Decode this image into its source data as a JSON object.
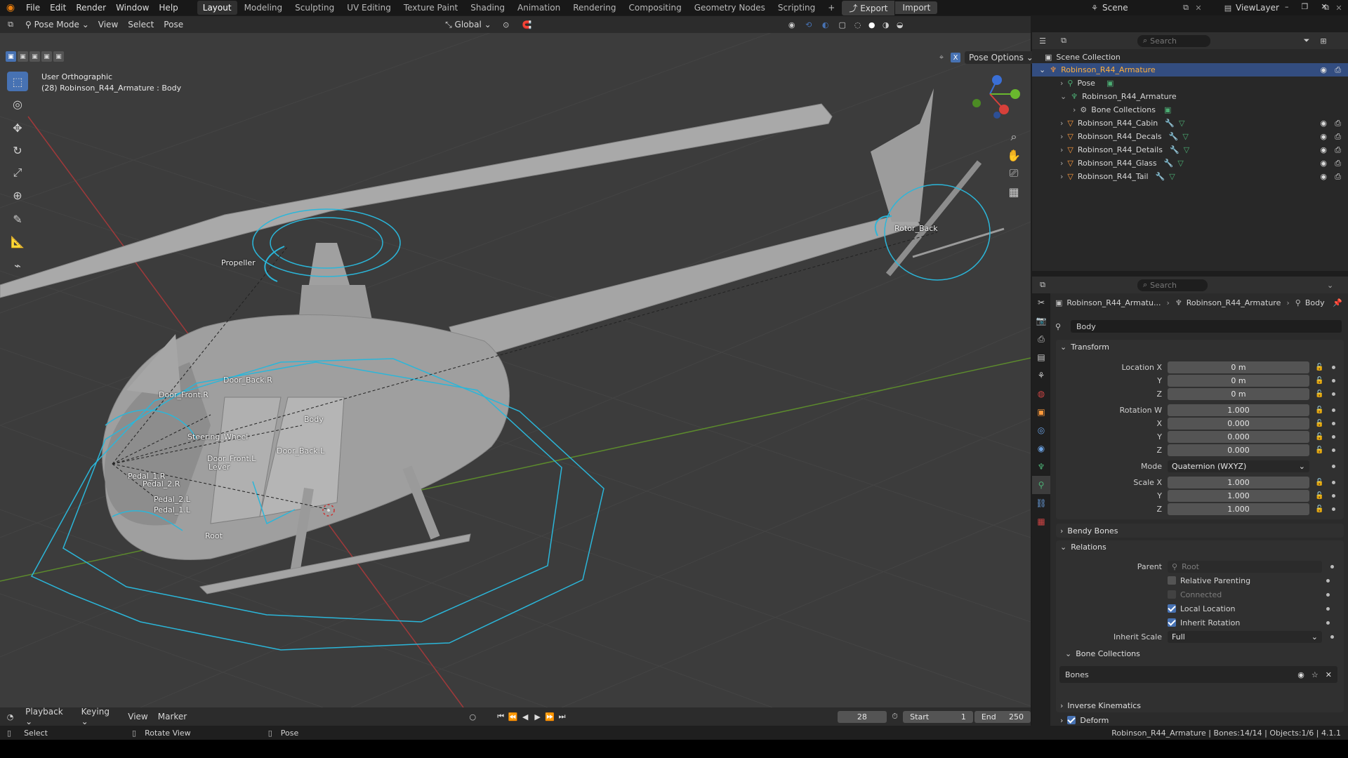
{
  "topbar": {
    "menus": [
      "File",
      "Edit",
      "Render",
      "Window",
      "Help"
    ],
    "workspaces": [
      "Layout",
      "Modeling",
      "Sculpting",
      "UV Editing",
      "Texture Paint",
      "Shading",
      "Animation",
      "Rendering",
      "Compositing",
      "Geometry Nodes",
      "Scripting"
    ],
    "active_workspace": "Layout",
    "export_label": "Export",
    "import_label": "Import",
    "scene_label": "Scene",
    "viewlayer_label": "ViewLayer"
  },
  "viewport": {
    "mode": "Pose Mode",
    "menus": [
      "View",
      "Select",
      "Pose"
    ],
    "orientation": "Global",
    "pose_options": "Pose Options",
    "view_name": "User Orthographic",
    "active_info": "(28) Robinson_R44_Armature : Body",
    "bone_labels": [
      "Propeller",
      "Rotor_Back",
      "Door_Back.R",
      "Door_Front.R",
      "Body",
      "Steering_Wheel",
      "Door_Back.L",
      "Door_Front.L",
      "Lever",
      "Pedal_1.R",
      "Pedal_2.R",
      "Pedal_2.L",
      "Pedal_1.L",
      "Root"
    ]
  },
  "outliner": {
    "search_placeholder": "Search",
    "root": "Scene Collection",
    "items": [
      {
        "label": "Robinson_R44_Armature",
        "selected": true
      },
      {
        "label": "Pose"
      },
      {
        "label": "Robinson_R44_Armature"
      },
      {
        "label": "Bone Collections"
      },
      {
        "label": "Robinson_R44_Cabin"
      },
      {
        "label": "Robinson_R44_Decals"
      },
      {
        "label": "Robinson_R44_Details"
      },
      {
        "label": "Robinson_R44_Glass"
      },
      {
        "label": "Robinson_R44_Tail"
      }
    ]
  },
  "properties": {
    "search_placeholder": "Search",
    "breadcrumb": [
      "Robinson_R44_Armatu...",
      "Robinson_R44_Armature",
      "Body"
    ],
    "bone_name": "Body",
    "transform": {
      "title": "Transform",
      "location_label": "Location X",
      "location": [
        "0 m",
        "0 m",
        "0 m"
      ],
      "rotation_label": "Rotation W",
      "rotation": [
        "1.000",
        "0.000",
        "0.000",
        "0.000"
      ],
      "mode_label": "Mode",
      "mode": "Quaternion (WXYZ)",
      "scale_label": "Scale X",
      "scale": [
        "1.000",
        "1.000",
        "1.000"
      ],
      "axis_x": "X",
      "axis_y": "Y",
      "axis_z": "Z"
    },
    "bendy_bones": "Bendy Bones",
    "relations": {
      "title": "Relations",
      "parent_label": "Parent",
      "parent_value": "Root",
      "relative_parenting": "Relative Parenting",
      "connected": "Connected",
      "local_location": "Local Location",
      "inherit_rotation": "Inherit Rotation",
      "inherit_scale_label": "Inherit Scale",
      "inherit_scale": "Full",
      "bone_collections": "Bone Collections",
      "bones_item": "Bones"
    },
    "inverse_kinematics": "Inverse Kinematics",
    "deform": "Deform"
  },
  "timeline": {
    "menus": [
      "Playback",
      "Keying",
      "View",
      "Marker"
    ],
    "current_frame": "28",
    "start_label": "Start",
    "start": "1",
    "end_label": "End",
    "end": "250"
  },
  "statusbar": {
    "select": "Select",
    "rotate": "Rotate View",
    "pose": "Pose",
    "info": "Robinson_R44_Armature | Bones:14/14 | Objects:1/6 | 4.1.1"
  },
  "colors": {
    "accent": "#4772b3",
    "selection_text": "#ffaf3d",
    "bone_outline": "#2bb6d9",
    "viewport_bg": "#3c3c3c"
  }
}
